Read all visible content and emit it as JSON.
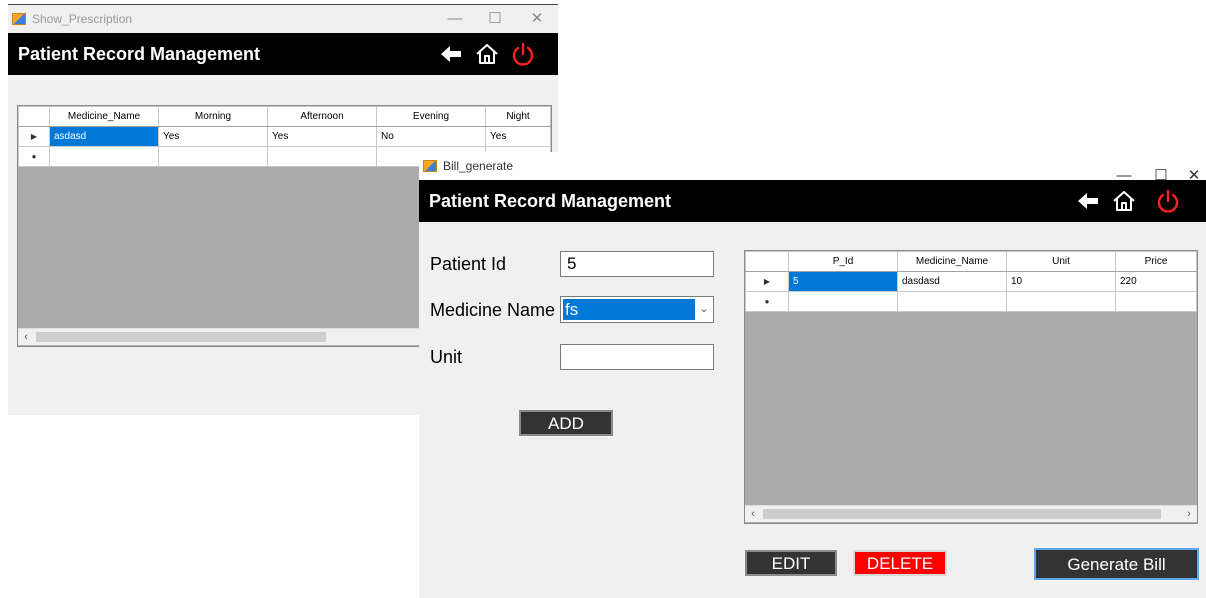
{
  "colors": {
    "banner": "#000000",
    "selection": "#0078d7",
    "power": "#ff2020",
    "delete": "#ff0000",
    "grid_bg": "#ababab"
  },
  "window_controls": {
    "minimize": "—",
    "maximize": "☐",
    "close": "✕"
  },
  "icons": {
    "back": "back-arrow-icon",
    "home": "home-icon",
    "power": "power-icon"
  },
  "prescription_window": {
    "title": "Show_Prescription",
    "banner": "Patient Record Management",
    "grid": {
      "columns": [
        "Medicine_Name",
        "Morning",
        "Afternoon",
        "Evening",
        "Night"
      ],
      "rows": [
        [
          "asdasd",
          "Yes",
          "Yes",
          "No",
          "Yes"
        ]
      ]
    }
  },
  "bill_window": {
    "title": "Bill_generate",
    "banner": "Patient Record Management",
    "form": {
      "patient_id_label": "Patient Id",
      "patient_id_value": "5",
      "medicine_label": "Medicine Name",
      "medicine_value": "fs",
      "unit_label": "Unit",
      "unit_value": ""
    },
    "buttons": {
      "add": "ADD",
      "edit": "EDIT",
      "delete": "DELETE",
      "generate": "Generate Bill"
    },
    "grid": {
      "columns": [
        "P_Id",
        "Medicine_Name",
        "Unit",
        "Price"
      ],
      "rows": [
        [
          "5",
          "dasdasd",
          "10",
          "220"
        ]
      ]
    }
  }
}
